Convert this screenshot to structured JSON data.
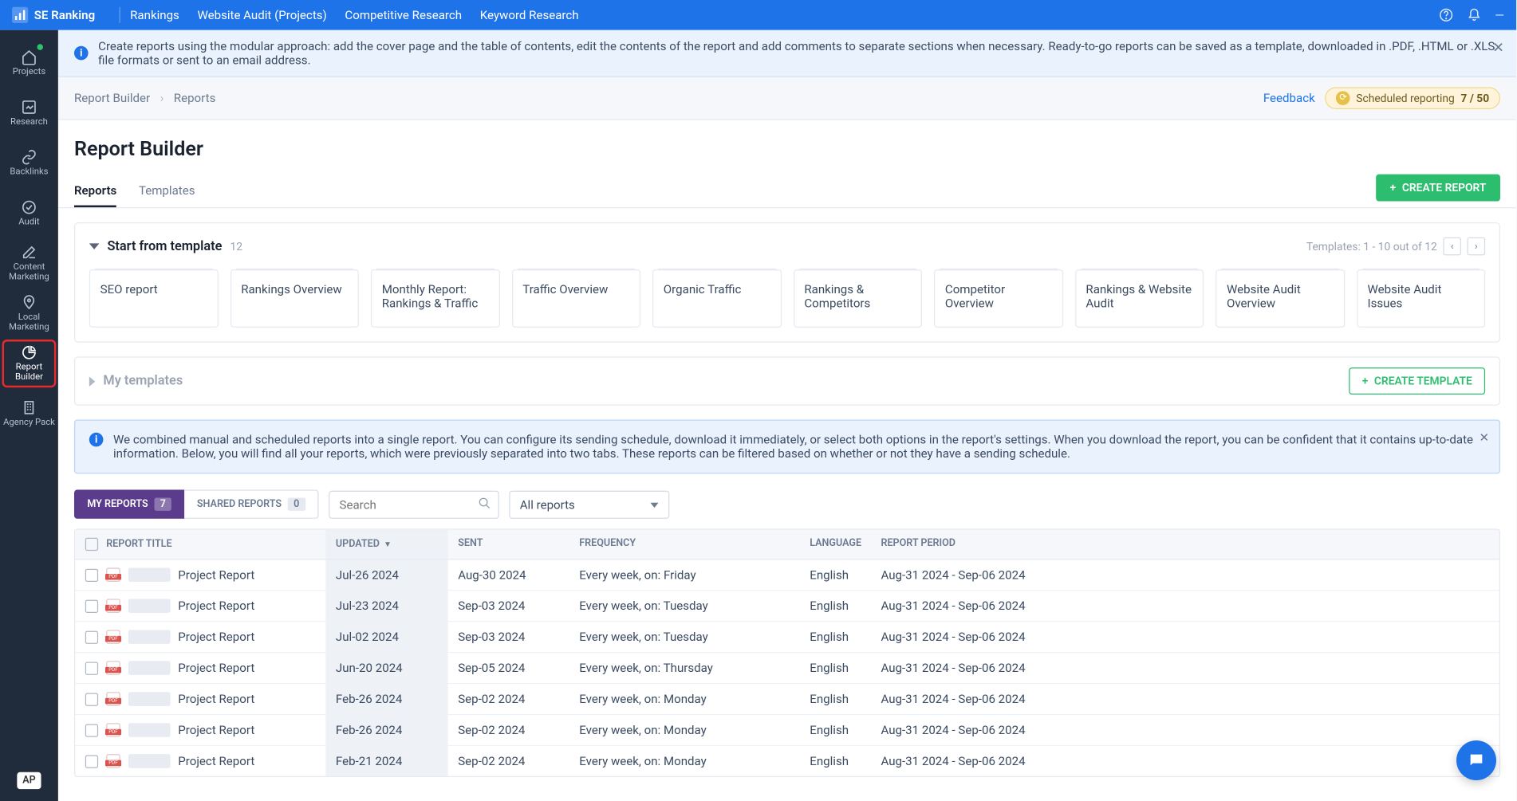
{
  "brand": "SE Ranking",
  "topnav": [
    "Rankings",
    "Website Audit (Projects)",
    "Competitive Research",
    "Keyword Research"
  ],
  "banner_text": "Create reports using the modular approach: add the cover page and the table of contents, edit the contents of the report and add comments to separate sections when necessary. Ready-to-go reports can be saved as a template, downloaded in .PDF, .HTML or .XLS file formats or sent to an email address.",
  "breadcrumb": {
    "root": "Report Builder",
    "current": "Reports"
  },
  "feedback_label": "Feedback",
  "scheduled": {
    "label": "Scheduled reporting",
    "count": "7 / 50"
  },
  "page_title": "Report Builder",
  "tabs": {
    "reports": "Reports",
    "templates": "Templates"
  },
  "create_report_btn": "CREATE REPORT",
  "create_template_btn": "CREATE TEMPLATE",
  "sidebar": [
    {
      "label": "Projects"
    },
    {
      "label": "Research"
    },
    {
      "label": "Backlinks"
    },
    {
      "label": "Audit"
    },
    {
      "label": "Content Marketing"
    },
    {
      "label": "Local Marketing"
    },
    {
      "label": "Report Builder"
    },
    {
      "label": "Agency Pack"
    }
  ],
  "sidebar_footer": "AP",
  "template_section": {
    "title": "Start from template",
    "count": "12",
    "range": "Templates: 1 - 10 out of 12",
    "cards": [
      "SEO report",
      "Rankings Overview",
      "Monthly Report: Rankings & Traffic",
      "Traffic Overview",
      "Organic Traffic",
      "Rankings & Competitors",
      "Competitor Overview",
      "Rankings & Website Audit",
      "Website Audit Overview",
      "Website Audit Issues"
    ]
  },
  "my_templates_label": "My templates",
  "info_box": "We combined manual and scheduled reports into a single report. You can configure its sending schedule, download it immediately, or select both options in the report's settings. When you download the report, you can be confident that it contains up-to-date information. Below, you will find all your reports, which were previously separated into two tabs. These reports can be filtered based on whether or not they have a sending schedule.",
  "filter_tabs": {
    "my": {
      "label": "MY REPORTS",
      "count": "7"
    },
    "shared": {
      "label": "SHARED REPORTS",
      "count": "0"
    }
  },
  "search_placeholder": "Search",
  "select_value": "All reports",
  "table": {
    "headers": {
      "title": "REPORT TITLE",
      "updated": "UPDATED",
      "sent": "SENT",
      "freq": "FREQUENCY",
      "lang": "LANGUAGE",
      "period": "REPORT PERIOD"
    },
    "rows": [
      {
        "title": "Project Report",
        "updated": "Jul-26 2024",
        "sent": "Aug-30 2024",
        "freq": "Every week, on: Friday",
        "lang": "English",
        "period": "Aug-31 2024 - Sep-06 2024"
      },
      {
        "title": "Project Report",
        "updated": "Jul-23 2024",
        "sent": "Sep-03 2024",
        "freq": "Every week, on: Tuesday",
        "lang": "English",
        "period": "Aug-31 2024 - Sep-06 2024"
      },
      {
        "title": "Project Report",
        "updated": "Jul-02 2024",
        "sent": "Sep-03 2024",
        "freq": "Every week, on: Tuesday",
        "lang": "English",
        "period": "Aug-31 2024 - Sep-06 2024"
      },
      {
        "title": "Project Report",
        "updated": "Jun-20 2024",
        "sent": "Sep-05 2024",
        "freq": "Every week, on: Thursday",
        "lang": "English",
        "period": "Aug-31 2024 - Sep-06 2024"
      },
      {
        "title": "Project Report",
        "updated": "Feb-26 2024",
        "sent": "Sep-02 2024",
        "freq": "Every week, on: Monday",
        "lang": "English",
        "period": "Aug-31 2024 - Sep-06 2024"
      },
      {
        "title": "Project Report",
        "updated": "Feb-26 2024",
        "sent": "Sep-02 2024",
        "freq": "Every week, on: Monday",
        "lang": "English",
        "period": "Aug-31 2024 - Sep-06 2024"
      },
      {
        "title": "Project Report",
        "updated": "Feb-21 2024",
        "sent": "Sep-02 2024",
        "freq": "Every week, on: Monday",
        "lang": "English",
        "period": "Aug-31 2024 - Sep-06 2024"
      }
    ]
  }
}
